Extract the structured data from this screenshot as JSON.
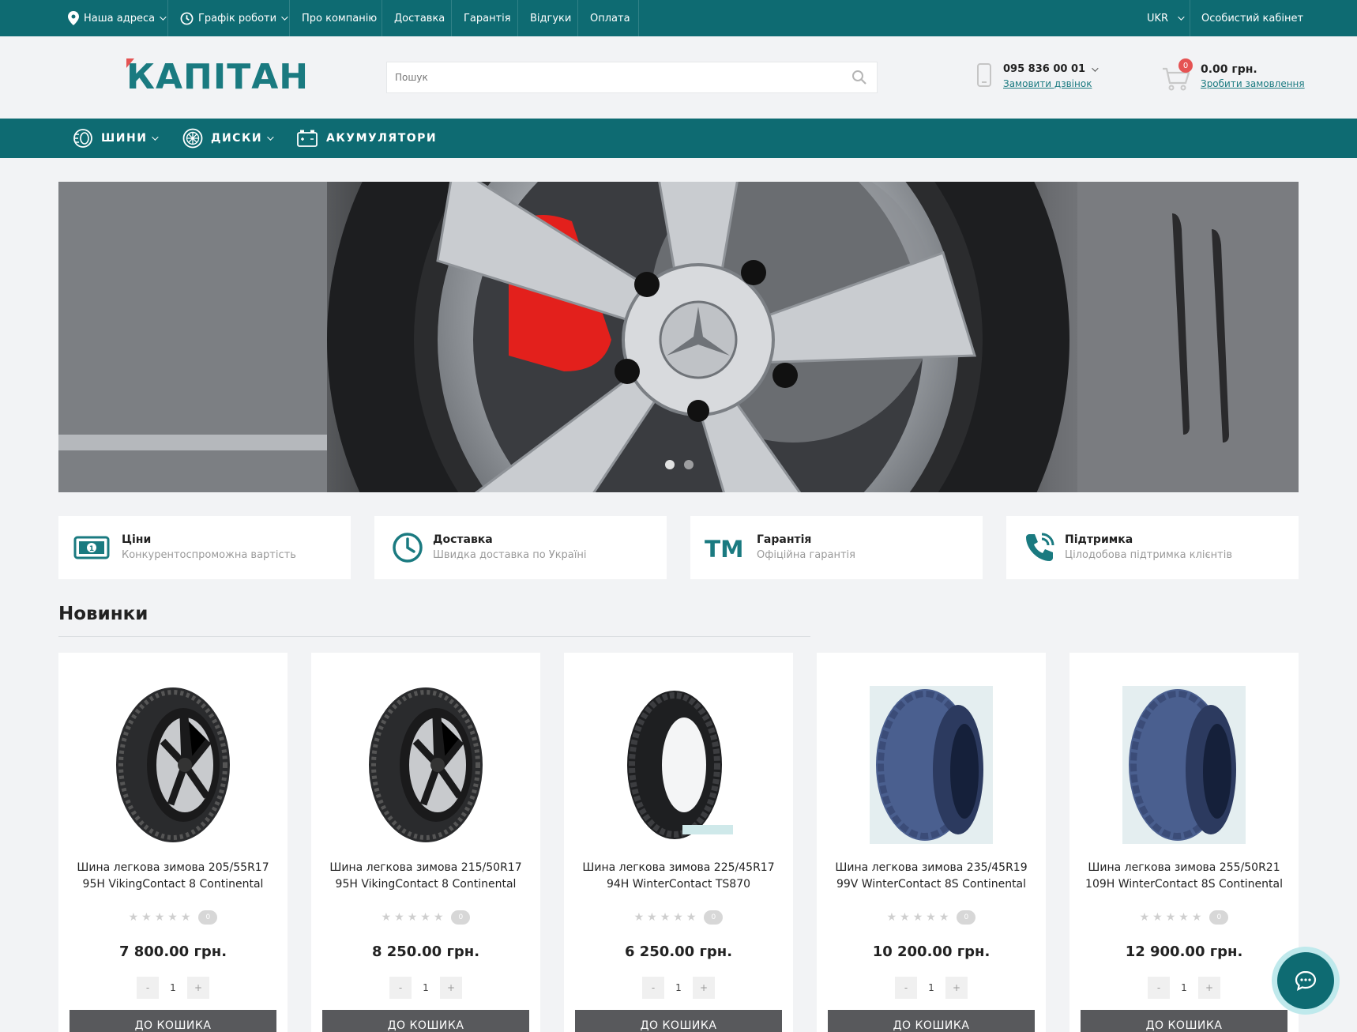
{
  "topbar": {
    "address_label": "Наша адреса",
    "schedule_label": "Графік роботи",
    "links": [
      "Про компанію",
      "Доставка",
      "Гарантія",
      "Відгуки",
      "Оплата"
    ],
    "language": "UKR",
    "account_label": "Особистий кабінет"
  },
  "header": {
    "logo_text": "КАПІТАН",
    "search_placeholder": "Пошук",
    "phone": "095 836 00 01",
    "callback_label": "Замовити дзвінок",
    "cart_count": "0",
    "cart_total": "0.00 грн.",
    "order_label": "Зробити замовлення"
  },
  "categories": [
    {
      "label": "ШИНИ",
      "icon": "tire-icon",
      "dropdown": true
    },
    {
      "label": "ДИСКИ",
      "icon": "wheel-rim-icon",
      "dropdown": true
    },
    {
      "label": "АКУМУЛЯТОРИ",
      "icon": "battery-icon",
      "dropdown": false
    }
  ],
  "banner": {
    "slides": 2,
    "active_slide": 1
  },
  "features": [
    {
      "title": "Ціни",
      "desc": "Конкурентоспроможна вартість",
      "icon": "banknote-icon"
    },
    {
      "title": "Доставка",
      "desc": "Швидка доставка по Україні",
      "icon": "clock-icon"
    },
    {
      "title": "Гарантія",
      "desc": "Офіційна гарантія",
      "icon": "trademark-icon"
    },
    {
      "title": "Підтримка",
      "desc": "Цілодобова підтримка клієнтів",
      "icon": "phone-call-icon"
    }
  ],
  "section": {
    "title": "Новинки"
  },
  "products": [
    {
      "name": "Шина легкова зимова 205/55R17 95H VikingContact 8 Continental",
      "price": "7 800.00 грн.",
      "reviews": "0",
      "qty": "1",
      "button": "ДО КОШИКА"
    },
    {
      "name": "Шина легкова зимова 215/50R17 95H VikingContact 8 Continental",
      "price": "8 250.00 грн.",
      "reviews": "0",
      "qty": "1",
      "button": "ДО КОШИКА"
    },
    {
      "name": "Шина легкова зимова 225/45R17 94H WinterContact TS870",
      "price": "6 250.00 грн.",
      "reviews": "0",
      "qty": "1",
      "button": "ДО КОШИКА"
    },
    {
      "name": "Шина легкова зимова 235/45R19 99V WinterContact 8S Continental",
      "price": "10 200.00 грн.",
      "reviews": "0",
      "qty": "1",
      "button": "ДО КОШИКА"
    },
    {
      "name": "Шина легкова зимова 255/50R21 109H WinterContact 8S Continental",
      "price": "12 900.00 грн.",
      "reviews": "0",
      "qty": "1",
      "button": "ДО КОШИКА"
    }
  ],
  "qty_controls": {
    "minus": "-",
    "plus": "+"
  },
  "colors": {
    "brand": "#0e6b72",
    "accent_red": "#e55353",
    "button": "#58595c"
  }
}
